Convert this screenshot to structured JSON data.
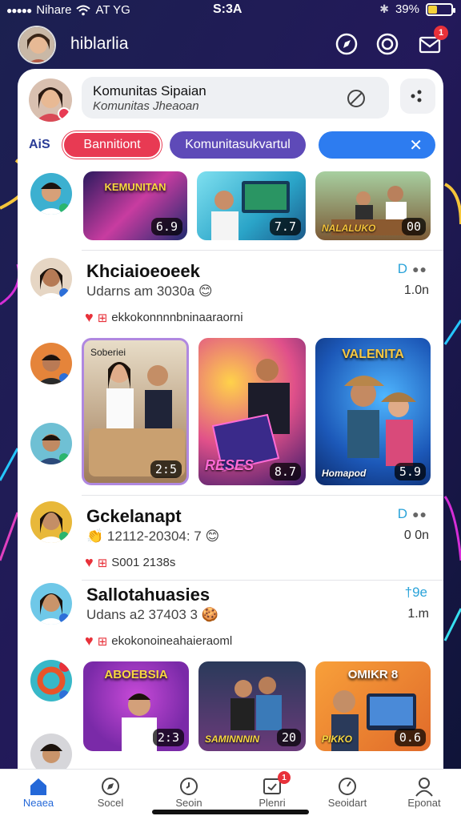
{
  "status": {
    "carrier": "Nihare",
    "network": "AT YG",
    "time": "S:3A",
    "battery": "39%",
    "battery_level": 0.39
  },
  "header": {
    "app_title": "hiblarlia",
    "notification_count": "1"
  },
  "composer": {
    "title": "Komunitas Sipaian",
    "subtitle": "Komunitas Jheaoan"
  },
  "filters": {
    "label": "AiS",
    "chips": [
      {
        "label": "Bannitiont",
        "color": "#e83a53"
      },
      {
        "label": "Komunitasukvartul",
        "color": "#5e4ab8"
      },
      {
        "label": "",
        "color": "#2d7cf0"
      }
    ]
  },
  "row1": {
    "thumbs": [
      {
        "title": "KEMUNITAN",
        "count": "6.9"
      },
      {
        "title": "",
        "count": "7.7"
      },
      {
        "caption": "NALALUKO",
        "count": "00"
      }
    ]
  },
  "posts": [
    {
      "name": "Khciaioeoeek",
      "meta": "Udarns am 3030a",
      "time": "1.0n",
      "reactions": "ekkokonnnnbninaaraorni",
      "ctl": "D"
    },
    {
      "name": "Gckelanapt",
      "meta": "12112-20304: 7",
      "time": "0 0n",
      "reactions": "S001 2138s",
      "ctl": "D"
    },
    {
      "name": "Sallotahuasies",
      "meta": "Udans a2 37403 3",
      "time": "1.m",
      "reactions": "ekokonoineahaieraoml",
      "ctl": "†9e"
    }
  ],
  "grid": {
    "thumbs": [
      {
        "title": "Soberiei",
        "count": "2:5"
      },
      {
        "title": "RESES",
        "count": "8.7"
      },
      {
        "title": "VALENITA",
        "caption": "Homapod",
        "count": "5.9"
      }
    ]
  },
  "row3": {
    "thumbs": [
      {
        "title": "ABOEBSIA",
        "count": "2:3"
      },
      {
        "caption": "SAMINNNIN",
        "count": "20"
      },
      {
        "title": "OMIKR 8",
        "caption": "PIKKO",
        "count": "0.6"
      }
    ]
  },
  "nav": [
    {
      "label": "Neaea"
    },
    {
      "label": "Socel"
    },
    {
      "label": "Seoin"
    },
    {
      "label": "Plenri",
      "badge": "1"
    },
    {
      "label": "Seoidart"
    },
    {
      "label": "Eponat"
    }
  ],
  "colors": {
    "accent": "#2468d8",
    "bg": "#161a4a",
    "red": "#e83a53",
    "purple": "#5e4ab8",
    "blue": "#2d7cf0"
  }
}
